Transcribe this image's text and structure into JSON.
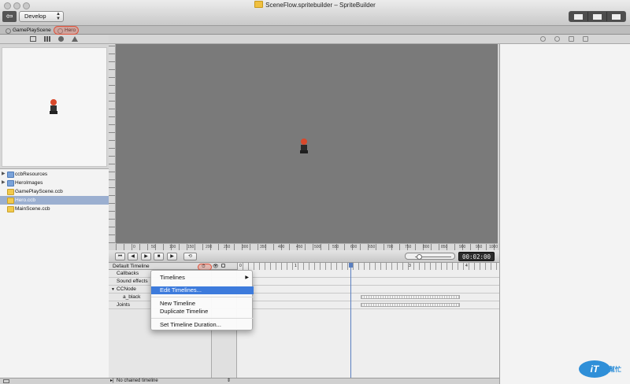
{
  "window": {
    "title": "SceneFlow.spritebuilder – SpriteBuilder"
  },
  "toolbar": {
    "project_select": "Develop"
  },
  "tabs": [
    {
      "label": "GamePlayScene"
    },
    {
      "label": "Hero"
    }
  ],
  "files": [
    {
      "label": "ccbResources",
      "kind": "folder"
    },
    {
      "label": "HeroImages",
      "kind": "folder"
    },
    {
      "label": "GamePlayScene.ccb",
      "kind": "ccb"
    },
    {
      "label": "Hero.ccb",
      "kind": "ccb",
      "selected": true
    },
    {
      "label": "MainScene.ccb",
      "kind": "ccb"
    }
  ],
  "ruler_bottom": [
    "0",
    "50",
    "100",
    "150",
    "200",
    "250",
    "300",
    "350",
    "400",
    "450",
    "500",
    "550",
    "600",
    "650",
    "700",
    "750",
    "800",
    "850",
    "900",
    "950",
    "1000"
  ],
  "timeline": {
    "time": "00:02:00",
    "header": "Default Timeline",
    "ruler": [
      "0",
      "1",
      "2",
      "3",
      "4"
    ],
    "rows": [
      {
        "label": "Callbacks"
      },
      {
        "label": "Sound effects"
      },
      {
        "label": "CCNode"
      },
      {
        "label": "a_black"
      },
      {
        "label": "Joints"
      }
    ],
    "chain_label": "No chained timeline"
  },
  "menu": {
    "items": [
      {
        "label": "Timelines"
      },
      {
        "label": "Edit Timelines..."
      },
      {
        "label": "New Timeline"
      },
      {
        "label": "Duplicate Timeline"
      },
      {
        "label": "Set Timeline Duration..."
      }
    ]
  },
  "watermark": {
    "logo": "iT",
    "text": "幫忙"
  },
  "colors": {
    "accent": "#3d7bdc",
    "highlight": "#e0533c",
    "stage": "#7a7a7a"
  }
}
